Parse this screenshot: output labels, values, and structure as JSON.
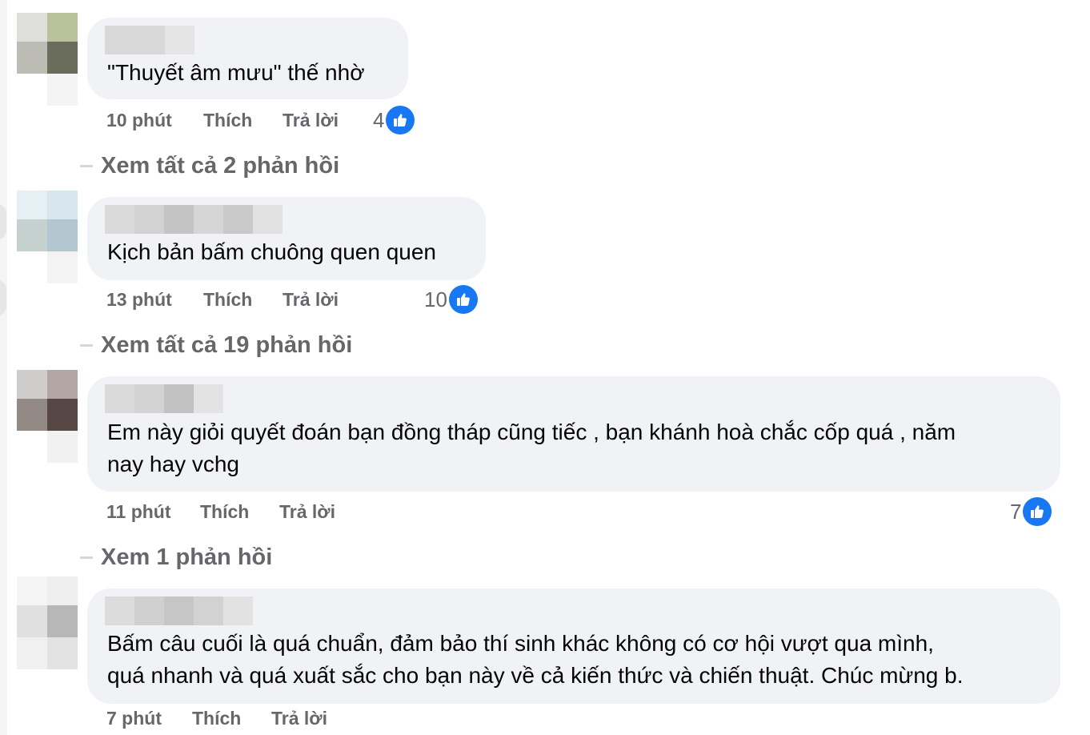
{
  "comments": [
    {
      "text": "\"Thuyết âm mưu\" thế nhờ",
      "time": "10 phút",
      "like_label": "Thích",
      "reply_label": "Trả lời",
      "reactions": "4",
      "view_replies": "Xem tất cả 2 phản hồi"
    },
    {
      "text": "Kịch bản bấm chuông quen quen",
      "time": "13 phút",
      "like_label": "Thích",
      "reply_label": "Trả lời",
      "reactions": "10",
      "view_replies": "Xem tất cả 19 phản hồi"
    },
    {
      "text_line1": "Em này giỏi quyết đoán bạn đồng tháp cũng tiếc , bạn khánh hoà chắc cốp quá , năm",
      "text_line2": "nay hay vchg",
      "time": "11 phút",
      "like_label": "Thích",
      "reply_label": "Trả lời",
      "reactions": "7",
      "view_replies": "Xem 1 phản hồi"
    },
    {
      "text_line1": "Bấm câu cuối là quá chuẩn, đảm bảo thí sinh khác không có cơ hội vượt qua mình,",
      "text_line2": "quá nhanh và quá xuất sắc cho bạn này về cả kiến thức và chiến thuật. Chúc mừng b.",
      "time": "7 phút",
      "like_label": "Thích",
      "reply_label": "Trả lời"
    }
  ],
  "colors": {
    "bubble": "#f0f2f5",
    "meta_text": "#65676b",
    "like_blue": "#1877f2"
  },
  "icons": {
    "reaction": "thumbs-up-icon"
  }
}
